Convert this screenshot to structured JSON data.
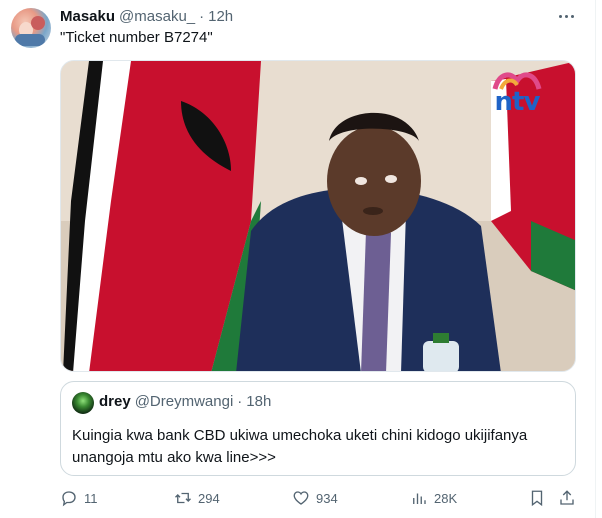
{
  "tweet": {
    "display_name": "Masaku",
    "handle": "@masaku_",
    "separator": "·",
    "time": "12h",
    "text": "\"Ticket number B7274\"",
    "avatar_icon": "user-avatar",
    "more_icon": "more-horizontal-icon"
  },
  "media": {
    "watermark": "ntv",
    "colors": {
      "flag_red": "#c8102e",
      "flag_green": "#1f7a3a",
      "suit": "#1e2f5a",
      "tie": "#6d5f93",
      "wall": "#e6dccf"
    }
  },
  "quote": {
    "display_name": "drey",
    "handle": "@Dreymwangi",
    "separator": "·",
    "time": "18h",
    "text": "Kuingia kwa bank CBD ukiwa umechoka uketi chini kidogo ukijifanya unangoja mtu ako kwa line>>>"
  },
  "actions": {
    "replies": "11",
    "retweets": "294",
    "likes": "934",
    "views": "28K",
    "icons": [
      "reply-icon",
      "retweet-icon",
      "like-icon",
      "views-icon",
      "bookmark-icon",
      "share-icon"
    ]
  }
}
